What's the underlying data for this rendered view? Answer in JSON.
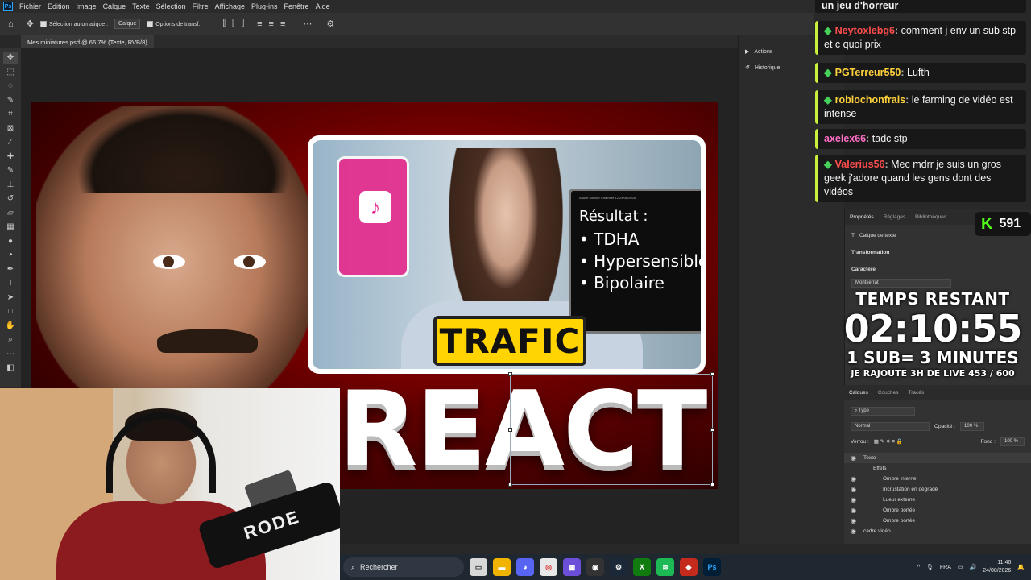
{
  "menubar": {
    "items": [
      "Fichier",
      "Edition",
      "Image",
      "Calque",
      "Texte",
      "Sélection",
      "Filtre",
      "Affichage",
      "Plug-ins",
      "Fenêtre",
      "Aide"
    ]
  },
  "options": {
    "auto_select_label": "Sélection automatique :",
    "layer_select": "Calque",
    "transform_label": "Options de transf."
  },
  "document": {
    "tab_title": "Mes miniatures.psd @ 66,7% (Texte, RVB/8)"
  },
  "thumbnail": {
    "monitor_header": "Adulte   Monitor   Chambre 12        24/08/2026",
    "monitor_title": "Résultat :",
    "monitor_items": [
      "• TDHA",
      "• Hypersensible",
      "• Bipolaire"
    ],
    "trafic_label": "TRAFIC",
    "react_label": "REACT",
    "tiktok_glyph": "♪"
  },
  "webcam": {
    "mic_brand": "RODE"
  },
  "mid_panel": {
    "actions_label": "Actions",
    "history_label": "Historique"
  },
  "chat": [
    {
      "user": "",
      "text": "un jeu d'horreur",
      "user_color": "#ffffff"
    },
    {
      "user": "Neytoxlebg6",
      "text": "comment j env un sub stp et c quoi prix",
      "user_color": "#ff4d4d"
    },
    {
      "user": "PGTerreur550",
      "text": "Lufth",
      "user_color": "#ffd23c"
    },
    {
      "user": "roblochonfrais",
      "text": "le farming de vidéo est intense",
      "user_color": "#ffd23c"
    },
    {
      "user": "axelex66",
      "text": "tadc stp",
      "user_color": "#ff6ec7"
    },
    {
      "user": "Valerius56",
      "text": "Mec mdrr je suis un gros geek j'adore quand les gens dont des vidéos",
      "user_color": "#ff4d4d"
    }
  ],
  "kick": {
    "logo": "K",
    "viewers": "591"
  },
  "properties": {
    "tabs": [
      "Propriétés",
      "Réglages",
      "Bibliothèques"
    ],
    "layer_type": "Calque de texte",
    "transformation": "Transformation",
    "character": "Caractère",
    "font": "Montserrat"
  },
  "timer": {
    "label": "TEMPS RESTANT",
    "time": "02:10:55",
    "rule": "1 SUB= 3 MINUTES",
    "goal": "JE RAJOUTE 3H DE LIVE 453 / 600"
  },
  "layers": {
    "tabs": [
      "Calques",
      "Couches",
      "Tracés"
    ],
    "filter": "Type",
    "blend_mode": "Normal",
    "opacity_label": "Opacité :",
    "opacity": "100 %",
    "lock_label": "Verrou :",
    "fill_label": "Fond :",
    "fill": "100 %",
    "rows": [
      {
        "name": "Texte",
        "indent": 0,
        "eye": true,
        "selected": true
      },
      {
        "name": "Effets",
        "indent": 1,
        "eye": false,
        "selected": false
      },
      {
        "name": "Ombre interne",
        "indent": 2,
        "eye": true,
        "selected": false
      },
      {
        "name": "Incrustation en dégradé",
        "indent": 2,
        "eye": true,
        "selected": false
      },
      {
        "name": "Lueur externe",
        "indent": 2,
        "eye": true,
        "selected": false
      },
      {
        "name": "Ombre portée",
        "indent": 2,
        "eye": true,
        "selected": false
      },
      {
        "name": "Ombre portée",
        "indent": 2,
        "eye": true,
        "selected": false
      },
      {
        "name": "cadre vidéo",
        "indent": 0,
        "eye": true,
        "selected": false
      }
    ]
  },
  "taskbar": {
    "search_placeholder": "Rechercher",
    "language": "FRA",
    "time": "11:46",
    "date": "24/08/2026"
  },
  "colors": {
    "accent_kick": "#53fc18",
    "chat_border": "#c8f03c",
    "trafic_bg": "#ffd400"
  }
}
